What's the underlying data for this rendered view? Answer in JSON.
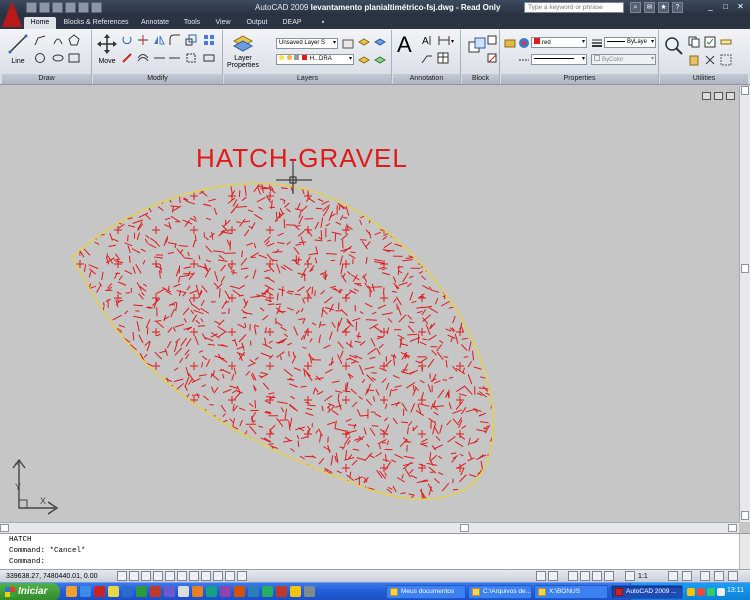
{
  "titlebar": {
    "app_name": "AutoCAD 2009",
    "file_name": "levantamento planialtimétrico-fsj.dwg",
    "mode": "- Read Only",
    "search_placeholder": "Type a keyword or phrase"
  },
  "ribbon_tabs": [
    "Home",
    "Blocks & References",
    "Annotate",
    "Tools",
    "View",
    "Output",
    "DEAP"
  ],
  "ribbon": {
    "draw": {
      "title": "Draw",
      "line_label": "Line"
    },
    "modify": {
      "title": "Modify",
      "move_label": "Move"
    },
    "layers": {
      "title": "Layers",
      "layer_properties_label": "Layer\nProperties",
      "layer_state": "Unsaved Layer S",
      "current_layer": "H...DRA"
    },
    "annotation": {
      "title": "Annotation"
    },
    "block": {
      "title": "Block"
    },
    "properties": {
      "title": "Properties",
      "color": "red",
      "lineweight": "ByLaye",
      "linetype": "ByColor"
    },
    "utilities": {
      "title": "Utilities"
    }
  },
  "drawing": {
    "hatch_title": "HATCH-GRAVEL",
    "hatch_color": "#e01a1a",
    "boundary_color": "#e8d23a",
    "background": "#c6c6c6"
  },
  "ucs": {
    "y_label": "Y",
    "x_label": "X"
  },
  "command_line": {
    "lines": [
      "HATCH",
      "Command: *Cancel*",
      "Command:"
    ]
  },
  "statusbar": {
    "coordinates": "339638.27, 7480440.01, 0.00",
    "annotation_scale": "1:1"
  },
  "taskbar": {
    "start_label": "Iniciar",
    "tasks": [
      "Meus documentos",
      "C:\\Arquivos de...",
      "X:\\BONUS",
      "AutoCAD 2009 ..."
    ],
    "clock": "13:11"
  }
}
